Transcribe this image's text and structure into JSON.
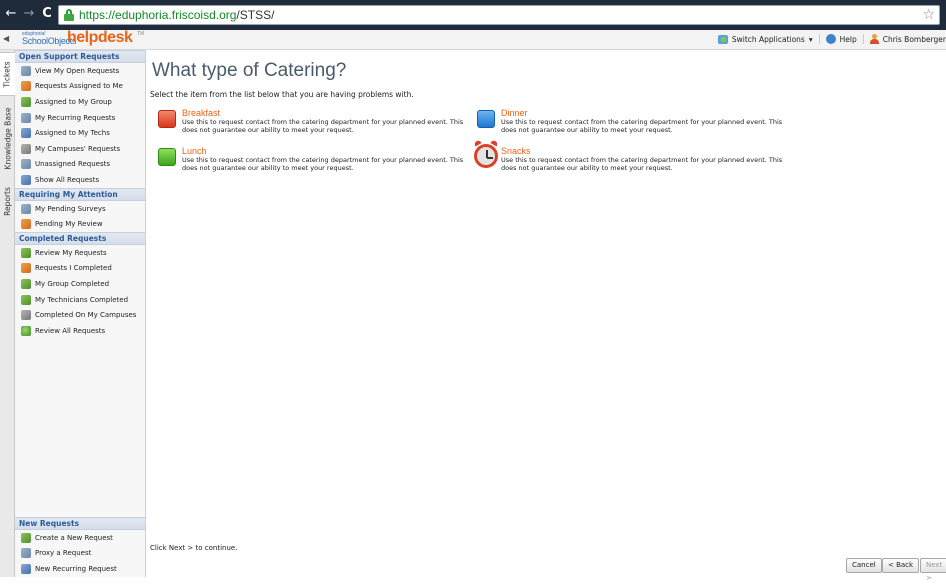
{
  "browser": {
    "url_host": "https://eduphoria.friscoisd.org",
    "url_path": "/STSS/"
  },
  "header": {
    "logo_small": "eduphoria!",
    "logo_product": "SchoolObjects",
    "logo_name": "helpdesk",
    "logo_tm": "TM",
    "switch_apps": "Switch Applications",
    "help": "Help",
    "user": "Chris Bomberger"
  },
  "vtabs": [
    "Tickets",
    "Knowledge Base",
    "Reports"
  ],
  "sidebar": {
    "open_header": "Open Support Requests",
    "open_items": [
      "View My Open Requests",
      "Requests Assigned to Me",
      "Assigned to My Group",
      "My Recurring Requests",
      "Assigned to My Techs",
      "My Campuses' Requests",
      "Unassigned Requests",
      "Show All Requests"
    ],
    "attention_header": "Requiring My Attention",
    "attention_items": [
      "My Pending Surveys",
      "Pending My Review"
    ],
    "completed_header": "Completed Requests",
    "completed_items": [
      "Review My Requests",
      "Requests I Completed",
      "My Group Completed",
      "My Technicians Completed",
      "Completed On My Campuses",
      "Review All Requests"
    ],
    "new_header": "New Requests",
    "new_items": [
      "Create a New Request",
      "Proxy a Request",
      "New Recurring Request"
    ]
  },
  "main": {
    "title": "What type of Catering?",
    "instructions": "Select the item from the list below that you are having problems with.",
    "options": [
      {
        "title": "Breakfast",
        "desc": "Use this to request contact from the catering department for your planned event. This does not guarantee our ability to meet your request."
      },
      {
        "title": "Dinner",
        "desc": "Use this to request contact from the catering department for your planned event. This does not guarantee our ability to meet your request."
      },
      {
        "title": "Lunch",
        "desc": "Use this to request contact from the catering department for your planned event. This does not guarantee our ability to meet your request."
      },
      {
        "title": "Snacks",
        "desc": "Use this to request contact from the catering department for your planned event. This does not guarantee our ability to meet your request."
      }
    ],
    "footer": "Click Next > to continue.",
    "cancel": "Cancel",
    "back": "< Back",
    "next": "Next >"
  }
}
